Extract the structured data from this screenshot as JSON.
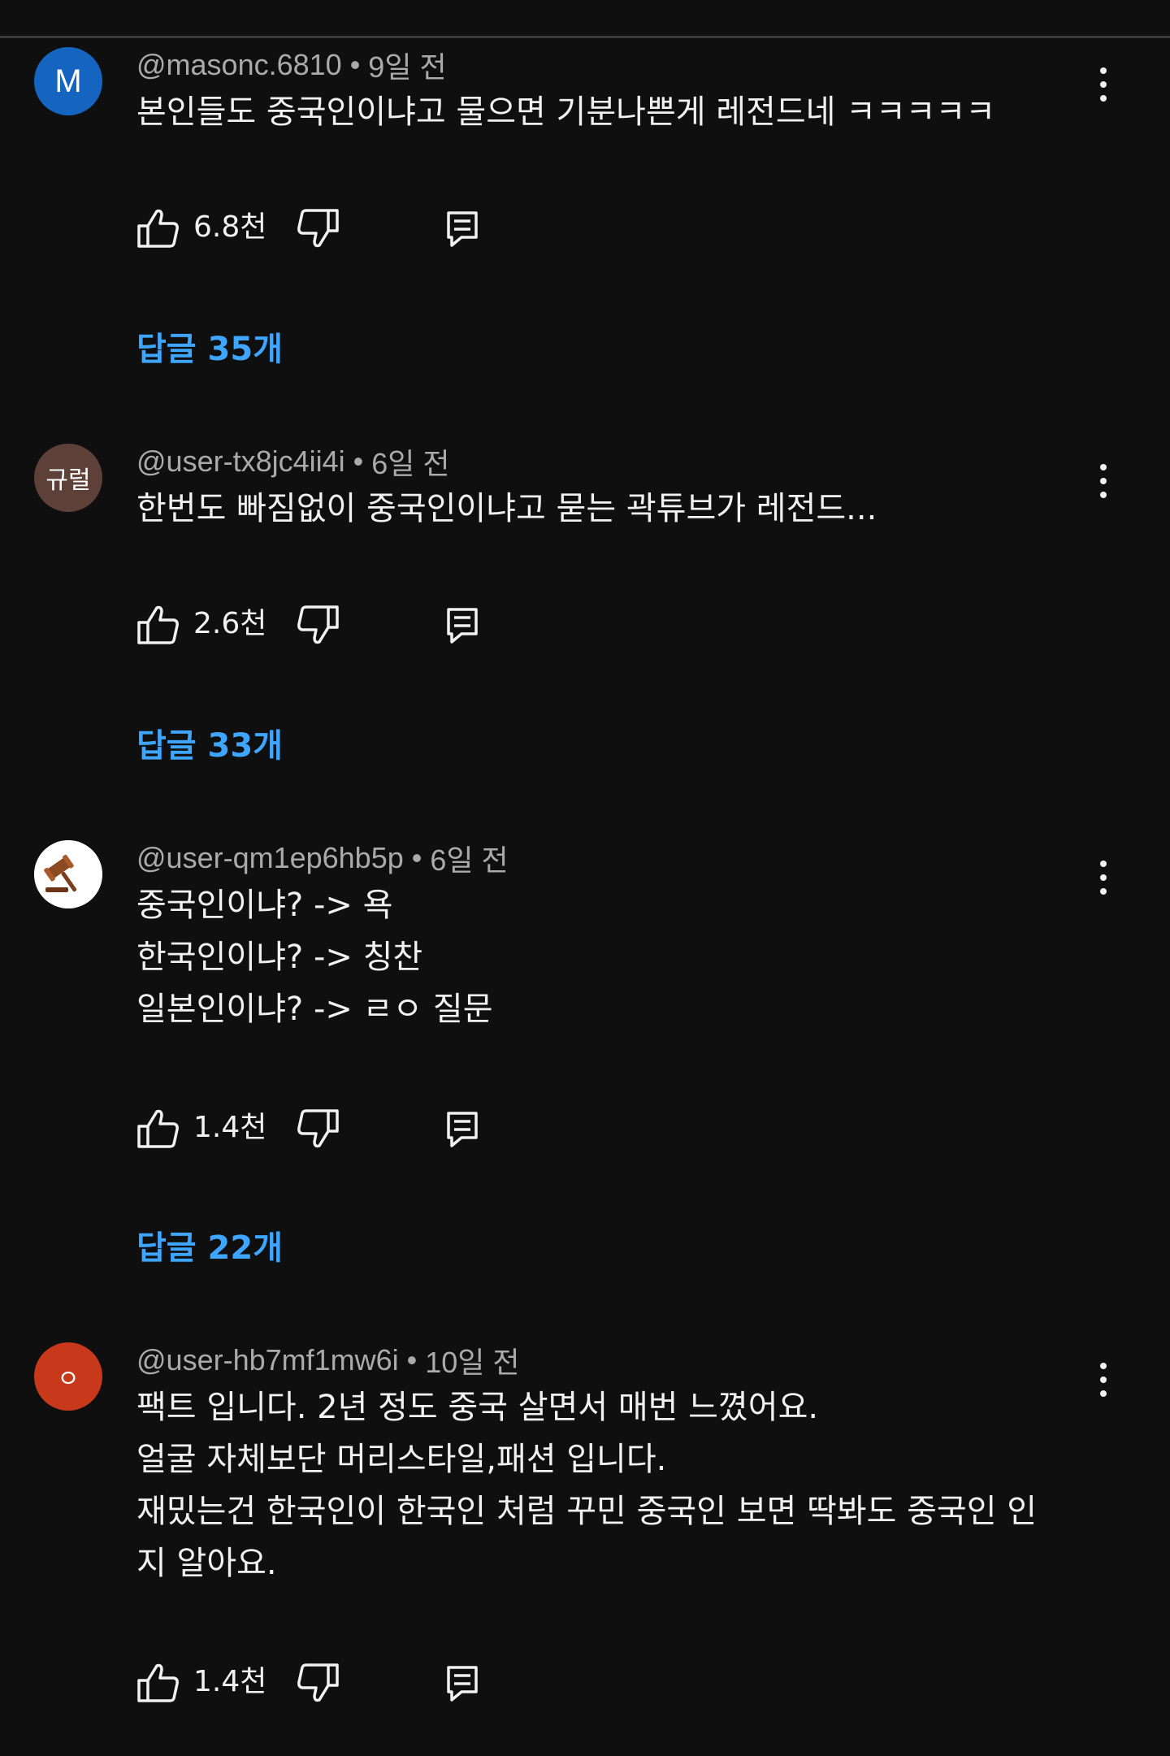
{
  "comments": [
    {
      "avatar_text": "M",
      "author": "@masonc.6810",
      "separator": "•",
      "time": "9일 전",
      "lines": [
        "본인들도 중국인이냐고 물으면 기분나쁜게 레전드네 ㅋㅋㅋㅋㅋ"
      ],
      "likes": "6.8천",
      "replies": "답글 35개",
      "avatar_color": "#1565c0"
    },
    {
      "avatar_text": "규럴",
      "author": "@user-tx8jc4ii4i",
      "separator": "•",
      "time": "6일 전",
      "lines": [
        "한번도 빠짐없이 중국인이냐고 묻는 곽튜브가 레전드..."
      ],
      "likes": "2.6천",
      "replies": "답글 33개",
      "avatar_color": "#5d4037"
    },
    {
      "avatar_icon": "gavel-icon",
      "author": "@user-qm1ep6hb5p",
      "separator": "•",
      "time": "6일 전",
      "lines": [
        "중국인이냐? -> 욕",
        "한국인이냐? -> 칭찬",
        "일본인이냐? -> ㄹㅇ 질문"
      ],
      "likes": "1.4천",
      "replies": "답글 22개",
      "avatar_color": "#ffffff"
    },
    {
      "avatar_text": "ㅇ",
      "author": "@user-hb7mf1mw6i",
      "separator": "•",
      "time": "10일 전",
      "lines": [
        "팩트 입니다. 2년 정도 중국 살면서 매번 느꼈어요.",
        "얼굴 자체보단 머리스타일,패션 입니다.",
        "재밌는건 한국인이 한국인 처럼 꾸민 중국인 보면 딱봐도 중국인 인",
        "지 알아요."
      ],
      "likes": "1.4천",
      "avatar_color": "#c8381a"
    }
  ],
  "colors": {
    "background": "#0f0f0f",
    "text": "#f1f1f1",
    "meta": "#aaaaaa",
    "link": "#3ea6ff"
  }
}
